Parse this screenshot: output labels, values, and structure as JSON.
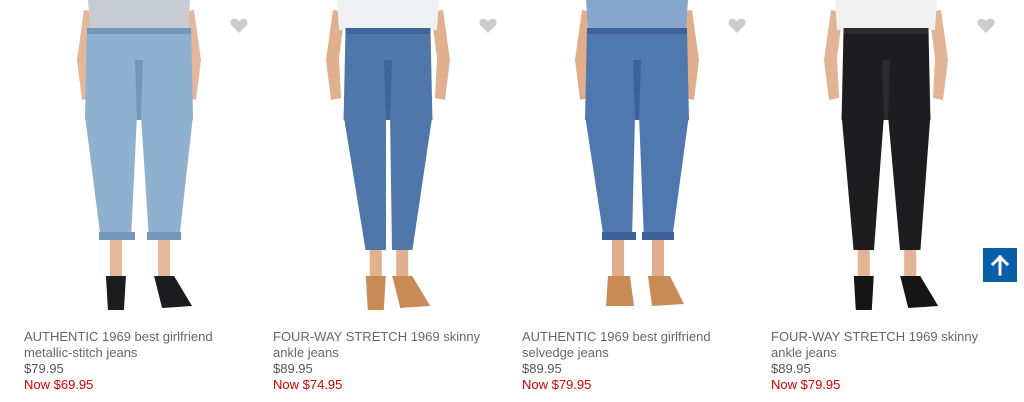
{
  "products": [
    {
      "name": "AUTHENTIC 1969 best girlfriend metallic-stitch jeans",
      "price": "$79.95",
      "sale_price": "Now $69.95",
      "favorite_icon": "heart-icon",
      "image": {
        "top_color": "#c7ccd3",
        "jeans_color": "#8fb1cf",
        "jeans_shade": "#7498ba",
        "shoe_color": "#1c1c1e",
        "skin_color": "#e2b79a"
      }
    },
    {
      "name": "FOUR-WAY STRETCH 1969 skinny ankle jeans",
      "price": "$89.95",
      "sale_price": "Now $74.95",
      "favorite_icon": "heart-icon",
      "image": {
        "top_color": "#eef0f2",
        "jeans_color": "#4f77aa",
        "jeans_shade": "#3f659a",
        "shoe_color": "#c98b55",
        "skin_color": "#e0b08f"
      }
    },
    {
      "name": "AUTHENTIC 1969 best girlfriend selvedge jeans",
      "price": "$89.95",
      "sale_price": "Now $79.95",
      "favorite_icon": "heart-icon",
      "image": {
        "top_color": "#86a6cb",
        "jeans_color": "#4f78ae",
        "jeans_shade": "#3c6298",
        "shoe_color": "#c98b55",
        "skin_color": "#e0ae8c"
      }
    },
    {
      "name": "FOUR-WAY STRETCH 1969 skinny ankle jeans",
      "price": "$89.95",
      "sale_price": "Now $79.95",
      "favorite_icon": "heart-icon",
      "image": {
        "top_color": "#f1f1f1",
        "jeans_color": "#1d1d20",
        "jeans_shade": "#2b2b30",
        "shoe_color": "#151515",
        "skin_color": "#e2b394"
      }
    }
  ],
  "back_to_top": {
    "icon": "arrow-up-icon",
    "color": "#0b5ea8"
  },
  "colors": {
    "sale": "#d50000",
    "heart": "#cccccc"
  }
}
